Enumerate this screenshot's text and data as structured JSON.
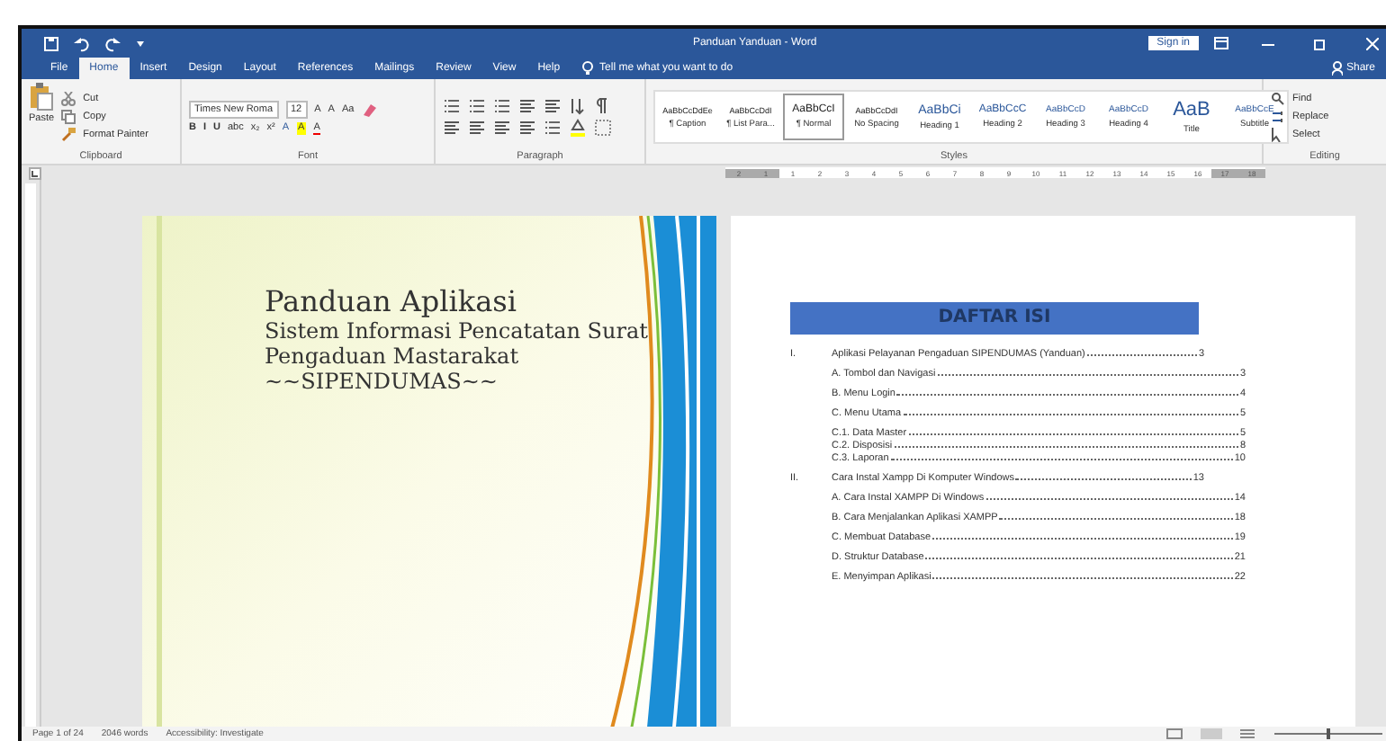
{
  "window": {
    "title": "Panduan Yanduan - Word",
    "sign_in": "Sign in"
  },
  "tabs": [
    {
      "label": "File",
      "selected": false
    },
    {
      "label": "Home",
      "selected": true
    },
    {
      "label": "Insert",
      "selected": false
    },
    {
      "label": "Design",
      "selected": false
    },
    {
      "label": "Layout",
      "selected": false
    },
    {
      "label": "References",
      "selected": false
    },
    {
      "label": "Mailings",
      "selected": false
    },
    {
      "label": "Review",
      "selected": false
    },
    {
      "label": "View",
      "selected": false
    },
    {
      "label": "Help",
      "selected": false
    }
  ],
  "tell_me": {
    "placeholder": "Tell me what you want to do"
  },
  "share": "Share",
  "clipboard": {
    "label": "Clipboard",
    "paste": "Paste",
    "cut": "Cut",
    "copy": "Copy",
    "format_painter": "Format Painter"
  },
  "font": {
    "label": "Font",
    "name": "Times New Roma",
    "size": "12",
    "row1": [
      "A",
      "A",
      "Aa"
    ],
    "row2": [
      "B",
      "I",
      "U",
      "abc",
      "x₂",
      "x²",
      "A",
      "A",
      "A"
    ]
  },
  "paragraph": {
    "label": "Paragraph"
  },
  "styles": {
    "label": "Styles",
    "items": [
      {
        "preview": "AaBbCcDdEe",
        "name": "¶ Caption",
        "selected": false
      },
      {
        "preview": "AaBbCcDdI",
        "name": "¶ List Para...",
        "selected": false
      },
      {
        "preview": "AaBbCcI",
        "name": "¶ Normal",
        "selected": true
      },
      {
        "preview": "AaBbCcDdI",
        "name": "No Spacing",
        "selected": false
      },
      {
        "preview": "AaBbCi",
        "name": "Heading 1",
        "selected": false
      },
      {
        "preview": "AaBbCcC",
        "name": "Heading 2",
        "selected": false
      },
      {
        "preview": "AaBbCcD",
        "name": "Heading 3",
        "selected": false
      },
      {
        "preview": "AaBbCcD",
        "name": "Heading 4",
        "selected": false
      },
      {
        "preview": "AaB",
        "name": "Title",
        "selected": false
      },
      {
        "preview": "AaBbCcE",
        "name": "Subtitle",
        "selected": false
      }
    ]
  },
  "editing": {
    "label": "Editing",
    "items": [
      "Find",
      "Replace",
      "Select"
    ]
  },
  "ruler": {
    "labels": [
      "2",
      "1",
      "1",
      "2",
      "3",
      "4",
      "5",
      "6",
      "7",
      "8",
      "9",
      "10",
      "11",
      "12",
      "13",
      "14",
      "15",
      "16",
      "17",
      "18"
    ]
  },
  "cover": {
    "title": "Panduan Aplikasi",
    "lines": [
      "Sistem Informasi Pencatatan Surat",
      "Pengaduan Mastarakat",
      "~~SIPENDUMAS~~"
    ]
  },
  "toc": {
    "heading": "DAFTAR ISI",
    "entries": [
      {
        "number": "I.",
        "title": "Aplikasi Pelayanan Pengaduan SIPENDUMAS (Yanduan)",
        "page": "3",
        "children": [
          {
            "title": "A. Tombol dan Navigasi",
            "page": "3"
          },
          {
            "title": "B. Menu Login",
            "page": "4"
          },
          {
            "title": "C. Menu Utama",
            "page": "5",
            "children": [
              {
                "title": "C.1. Data Master",
                "page": "5"
              },
              {
                "title": "C.2. Disposisi",
                "page": "8"
              },
              {
                "title": "C.3. Laporan",
                "page": "10"
              }
            ]
          }
        ]
      },
      {
        "number": "II.",
        "title": "Cara Instal Xampp Di Komputer Windows",
        "page": "13",
        "children": [
          {
            "title": "A. Cara Instal XAMPP Di Windows",
            "page": "14"
          },
          {
            "title": "B. Cara Menjalankan Aplikasi XAMPP",
            "page": "18"
          },
          {
            "title": "C. Membuat Database",
            "page": "19"
          },
          {
            "title": "D. Struktur Database",
            "page": "21"
          },
          {
            "title": "E. Menyimpan Aplikasi",
            "page": "22"
          }
        ]
      }
    ]
  },
  "status_bar": {
    "items": [
      "Page 1 of 24",
      "2046 words",
      "Accessibility: Investigate"
    ]
  }
}
